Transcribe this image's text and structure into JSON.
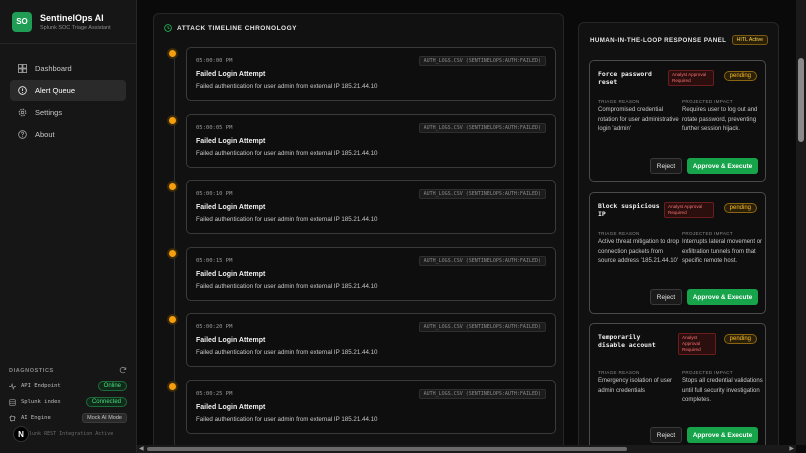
{
  "brand": {
    "logo": "SO",
    "title": "SentinelOps AI",
    "subtitle": "Splunk SOC Triage Assistant"
  },
  "nav": [
    {
      "label": "Dashboard",
      "icon": "grid-icon"
    },
    {
      "label": "Alert Queue",
      "icon": "alert-circle-icon",
      "active": true
    },
    {
      "label": "Settings",
      "icon": "gear-icon"
    },
    {
      "label": "About",
      "icon": "help-icon"
    }
  ],
  "diagnostics": {
    "heading": "DIAGNOSTICS",
    "rows": [
      {
        "label": "API Endpoint",
        "value": "Online"
      },
      {
        "label": "Splunk index",
        "value": "Connected"
      },
      {
        "label": "AI Engine",
        "value": "Mock AI Mode"
      }
    ],
    "footer": "Splunk REST Integration Active"
  },
  "avatar": "N",
  "timeline": {
    "title": "ATTACK TIMELINE CHRONOLOGY",
    "events": [
      {
        "time": "05:00:00 PM",
        "source": "AUTH_LOGS.CSV (SENTINELOPS:AUTH:FAILED)",
        "title": "Failed Login Attempt",
        "desc": "Failed authentication for user admin from external IP 185.21.44.10"
      },
      {
        "time": "05:00:05 PM",
        "source": "AUTH_LOGS.CSV (SENTINELOPS:AUTH:FAILED)",
        "title": "Failed Login Attempt",
        "desc": "Failed authentication for user admin from external IP 185.21.44.10"
      },
      {
        "time": "05:00:10 PM",
        "source": "AUTH_LOGS.CSV (SENTINELOPS:AUTH:FAILED)",
        "title": "Failed Login Attempt",
        "desc": "Failed authentication for user admin from external IP 185.21.44.10"
      },
      {
        "time": "05:00:15 PM",
        "source": "AUTH_LOGS.CSV (SENTINELOPS:AUTH:FAILED)",
        "title": "Failed Login Attempt",
        "desc": "Failed authentication for user admin from external IP 185.21.44.10"
      },
      {
        "time": "05:00:20 PM",
        "source": "AUTH_LOGS.CSV (SENTINELOPS:AUTH:FAILED)",
        "title": "Failed Login Attempt",
        "desc": "Failed authentication for user admin from external IP 185.21.44.10"
      },
      {
        "time": "05:00:25 PM",
        "source": "AUTH_LOGS.CSV (SENTINELOPS:AUTH:FAILED)",
        "title": "Failed Login Attempt",
        "desc": "Failed authentication for user admin from external IP 185.21.44.10"
      }
    ]
  },
  "hitl": {
    "title": "HUMAN-IN-THE-LOOP RESPONSE PANEL",
    "badge": "HITL Active",
    "reason_label": "TRIAGE REASON",
    "impact_label": "PROJECTED IMPACT",
    "reject_label": "Reject",
    "approve_label": "Approve & Execute",
    "cards": [
      {
        "title": "Force password reset",
        "required": "Analyst Approval Required",
        "status": "pending",
        "reason": "Compromised credential rotation for user administrative login 'admin'",
        "impact": "Requires user to log out and rotate password, preventing further session hijack."
      },
      {
        "title": "Block suspicious IP",
        "required": "Analyst Approval Required",
        "status": "pending",
        "reason": "Active threat mitigation to drop connection packets from source address '185.21.44.10'",
        "impact": "Interrupts lateral movement or exfiltration tunnels from that specific remote host."
      },
      {
        "title": "Temporarily disable account",
        "required": "Analyst Approval Required",
        "status": "pending",
        "reason": "Emergency isolation of user admin credentials",
        "impact": "Stops all credential validations until full security investigation completes."
      }
    ]
  },
  "colors": {
    "accent": "#16a34a",
    "pending": "#fbbf24",
    "event_dot": "#f59e0b",
    "danger": "#f87171"
  }
}
